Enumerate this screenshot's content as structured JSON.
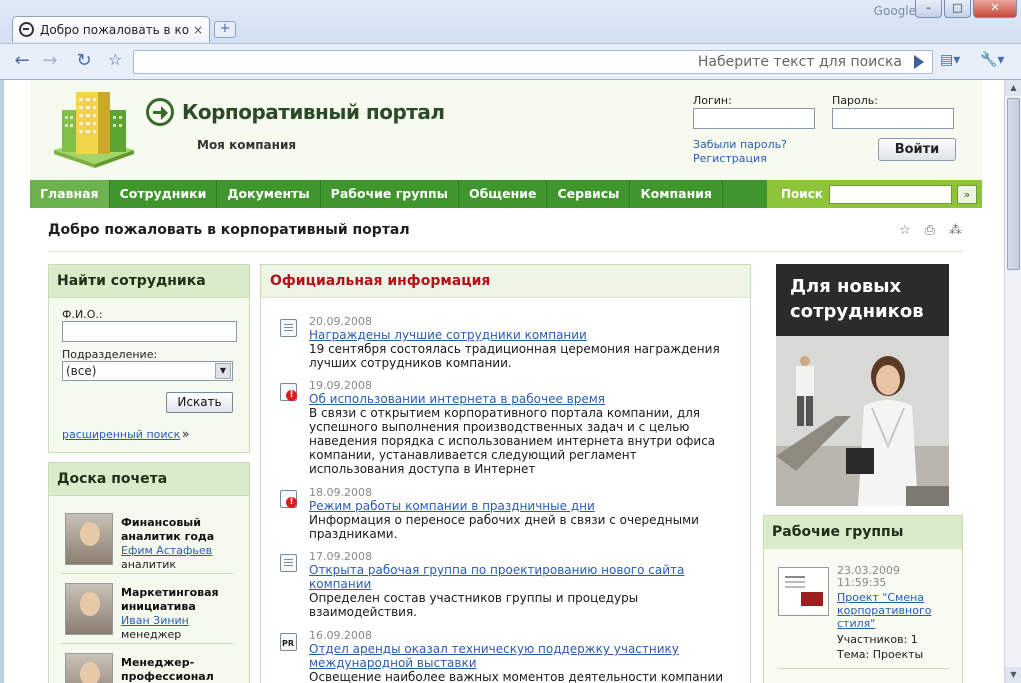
{
  "browser": {
    "tab_title": "Добро пожаловать в ко...",
    "tab_close": "×",
    "new_tab": "+",
    "brand": "Google",
    "search_placeholder": "Наберите текст для поиска"
  },
  "header": {
    "portal_name": "Корпоративный портал",
    "company": "Моя компания",
    "login_label": "Логин:",
    "password_label": "Пароль:",
    "forgot_link": "Забыли пароль?",
    "register_link": "Регистрация",
    "login_button": "Войти"
  },
  "nav": {
    "items": [
      "Главная",
      "Сотрудники",
      "Документы",
      "Рабочие группы",
      "Общение",
      "Сервисы",
      "Компания"
    ],
    "search_label": "Поиск",
    "search_button": "»"
  },
  "page": {
    "welcome": "Добро пожаловать в корпоративный портал"
  },
  "find_employee": {
    "title": "Найти сотрудника",
    "fio_label": "Ф.И.О.:",
    "dept_label": "Подразделение:",
    "dept_value": "(все)",
    "search_button": "Искать",
    "advanced_link": "расширенный поиск",
    "advanced_raquo": "»"
  },
  "honor_board": {
    "title": "Доска почета",
    "items": [
      {
        "title": "Финансовый аналитик года",
        "name": "Ефим Астафьев",
        "role": "аналитик"
      },
      {
        "title": "Маркетинговая инициатива",
        "name": "Иван Зинин",
        "role": "менеджер"
      },
      {
        "title": "Менеджер-профессионал",
        "name": "",
        "role": ""
      }
    ]
  },
  "official": {
    "title": "Официальная информация",
    "items": [
      {
        "icon": "document-icon",
        "date": "20.09.2008",
        "link": "Награждены лучшие сотрудники компании",
        "text": "19 сентября состоялась традиционная церемония награждения лучших сотрудников компании."
      },
      {
        "icon": "alert-icon",
        "date": "19.09.2008",
        "link": "Об использовании интернета в рабочее время",
        "text": "В связи с открытием корпоративного портала компании, для успешного выполнения производственных задач и с целью наведения порядка с использованием интернета внутри офиса компании, устанавливается следующий регламент использования доступа в Интернет"
      },
      {
        "icon": "alert-icon",
        "date": "18.09.2008",
        "link": "Режим работы компании в праздничные дни",
        "text": "Информация о переносе рабочих дней в связи с очередными праздниками."
      },
      {
        "icon": "document-icon",
        "date": "17.09.2008",
        "link": "Открыта рабочая группа по проектированию нового сайта компании",
        "text": "Определен состав участников группы и процедуры взаимодействия."
      },
      {
        "icon": "pr-icon",
        "date": "16.09.2008",
        "link": "Отдел аренды оказал техническую поддержку участнику международной выставки",
        "text": "Освещение наиболее важных моментов деятельности компании"
      }
    ]
  },
  "banner": {
    "title": "Для новых сотрудников"
  },
  "work_groups": {
    "title": "Рабочие группы",
    "date": "23.03.2009 11:59:35",
    "link": "Проект \"Смена корпоративного стиля\"",
    "members": "Участников: 1",
    "topic": "Тема: Проекты"
  }
}
